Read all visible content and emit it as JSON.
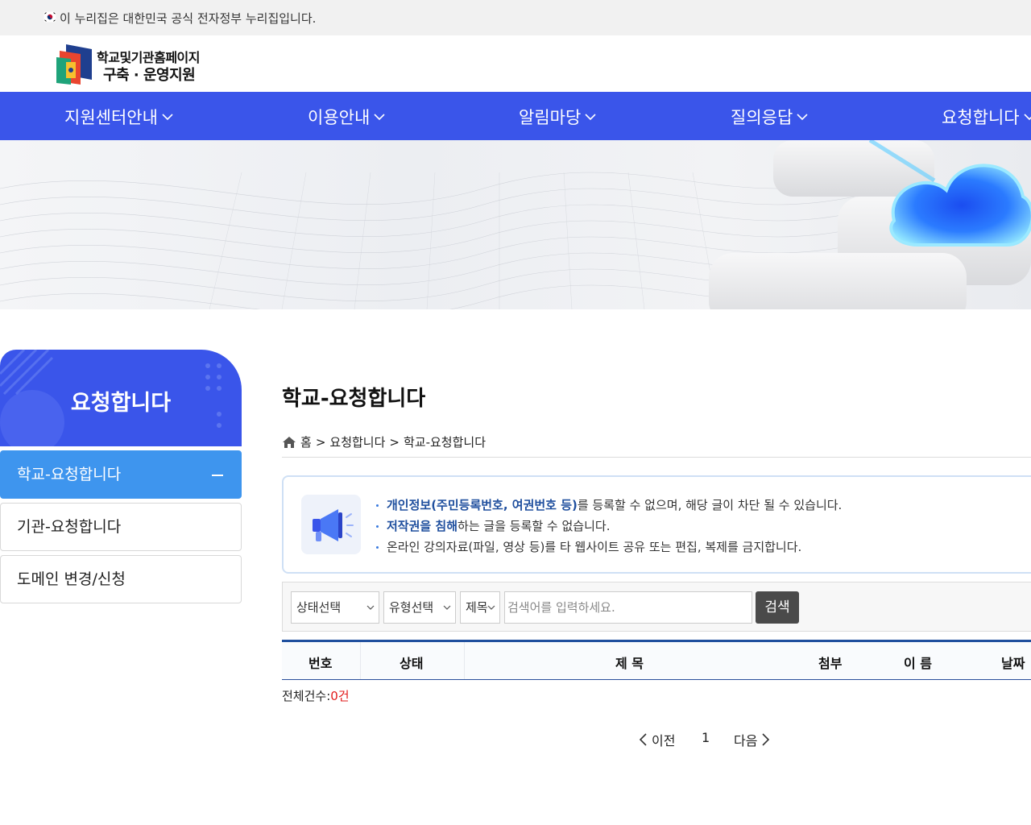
{
  "gov_banner": {
    "text": "이 누리집은 대한민국 공식 전자정부 누리집입니다."
  },
  "logo": {
    "line1": "학교및기관홈페이지",
    "line2": "구축 · 운영지원"
  },
  "gnb": {
    "items": [
      {
        "label": "지원센터안내"
      },
      {
        "label": "이용안내"
      },
      {
        "label": "알림마당"
      },
      {
        "label": "질의응답"
      },
      {
        "label": "요청합니다"
      }
    ]
  },
  "sidebar": {
    "title": "요청합니다",
    "items": [
      {
        "label": "학교-요청합니다",
        "active": true
      },
      {
        "label": "기관-요청합니다",
        "active": false
      },
      {
        "label": "도메인 변경/신청",
        "active": false
      }
    ]
  },
  "content": {
    "title": "학교-요청합니다",
    "breadcrumb": {
      "home": "홈",
      "sep": ">",
      "level1": "요청합니다",
      "level2": "학교-요청합니다"
    }
  },
  "notice": {
    "line1_hl": "개인정보(주민등록번호, 여권번호 등)",
    "line1_rest": "를 등록할 수 없으며, 해당 글이 차단 될 수 있습니다.",
    "line2_hl": "저작권을 침해",
    "line2_rest": "하는 글을 등록할 수 없습니다.",
    "line3": "온라인 강의자료(파일, 영상 등)를 타 웹사이트 공유 또는 편집, 복제를 금지합니다."
  },
  "search": {
    "status_select": "상태선택",
    "type_select": "유형선택",
    "field_select": "제목",
    "placeholder": "검색어를 입력하세요.",
    "button": "검색"
  },
  "table": {
    "columns": [
      "번호",
      "상태",
      "제 목",
      "첨부",
      "이 름",
      "날짜"
    ],
    "rows": []
  },
  "total": {
    "label": "전체건수:",
    "count": "0건"
  },
  "pagination": {
    "prev": "이전",
    "current": "1",
    "next": "다음"
  },
  "colors": {
    "primary": "#3a55ea",
    "active_menu": "#3e95ee",
    "table_border": "#1f4f9e",
    "count": "#e21b1b"
  }
}
